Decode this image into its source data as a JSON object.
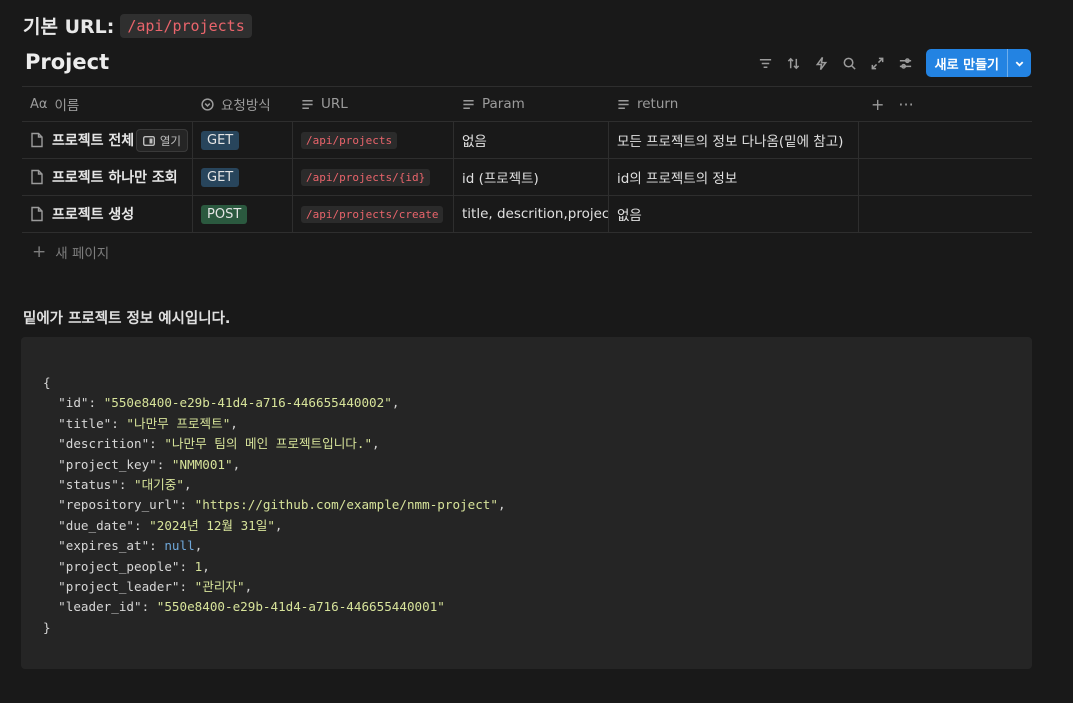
{
  "header": {
    "base_label": "기본 URL:",
    "base_url": "/api/projects"
  },
  "database": {
    "title": "Project",
    "toolbar_icons": [
      "filter-icon",
      "sort-icon",
      "lightning-icon",
      "search-icon",
      "expand-icon",
      "settings-icon"
    ],
    "new_button_label": "새로 만들기"
  },
  "table": {
    "columns": [
      {
        "prefix": "Aα",
        "label": "이름"
      },
      {
        "icon": "select-icon",
        "label": "요청방식"
      },
      {
        "icon": "text-icon",
        "label": "URL"
      },
      {
        "icon": "text-icon",
        "label": "Param"
      },
      {
        "icon": "text-icon",
        "label": "return"
      }
    ],
    "header_actions": [
      "+",
      "···"
    ],
    "open_label": "열기",
    "rows": [
      {
        "name": "프로젝트 전체",
        "method": "GET",
        "url": "/api/projects",
        "param": "없음",
        "return": "모든 프로젝트의 정보 다나옴(밑에 참고)"
      },
      {
        "name": "프로젝트 하나만 조회",
        "method": "GET",
        "url": "/api/projects/{id}",
        "param": "id (프로젝트)",
        "return": "id의 프로젝트의 정보"
      },
      {
        "name": "프로젝트 생성",
        "method": "POST",
        "url": "/api/projects/create",
        "param": "title, descrition,project_key",
        "return": "없음"
      }
    ],
    "new_page_label": "새 페이지"
  },
  "note": "밑에가 프로젝트 정보 예시입니다.",
  "code": {
    "open_brace": "{",
    "close_brace": "}",
    "lines": [
      {
        "key": "\"id\"",
        "value": "\"550e8400-e29b-41d4-a716-446655440002\"",
        "type": "string",
        "comma": ","
      },
      {
        "key": "\"title\"",
        "value": "\"나만무 프로젝트\"",
        "type": "string",
        "comma": ","
      },
      {
        "key": "\"descrition\"",
        "value": "\"나만무 팀의 메인 프로젝트입니다.\"",
        "type": "string",
        "comma": ","
      },
      {
        "key": "\"project_key\"",
        "value": "\"NMM001\"",
        "type": "string",
        "comma": ","
      },
      {
        "key": "\"status\"",
        "value": "\"대기중\"",
        "type": "string",
        "comma": ","
      },
      {
        "key": "\"repository_url\"",
        "value": "\"https://github.com/example/nmm-project\"",
        "type": "string",
        "comma": ","
      },
      {
        "key": "\"due_date\"",
        "value": "\"2024년 12월 31일\"",
        "type": "string",
        "comma": ","
      },
      {
        "key": "\"expires_at\"",
        "value": "null",
        "type": "null",
        "comma": ","
      },
      {
        "key": "\"project_people\"",
        "value": "1",
        "type": "number",
        "comma": ","
      },
      {
        "key": "\"project_leader\"",
        "value": "\"관리자\"",
        "type": "string",
        "comma": ","
      },
      {
        "key": "\"leader_id\"",
        "value": "\"550e8400-e29b-41d4-a716-446655440001\"",
        "type": "string",
        "comma": ""
      }
    ]
  },
  "colors": {
    "background": "#191919",
    "accent": "#2383e2",
    "code_red": "#e9646b",
    "tag_get": "#28455c",
    "tag_post": "#2b593f"
  }
}
